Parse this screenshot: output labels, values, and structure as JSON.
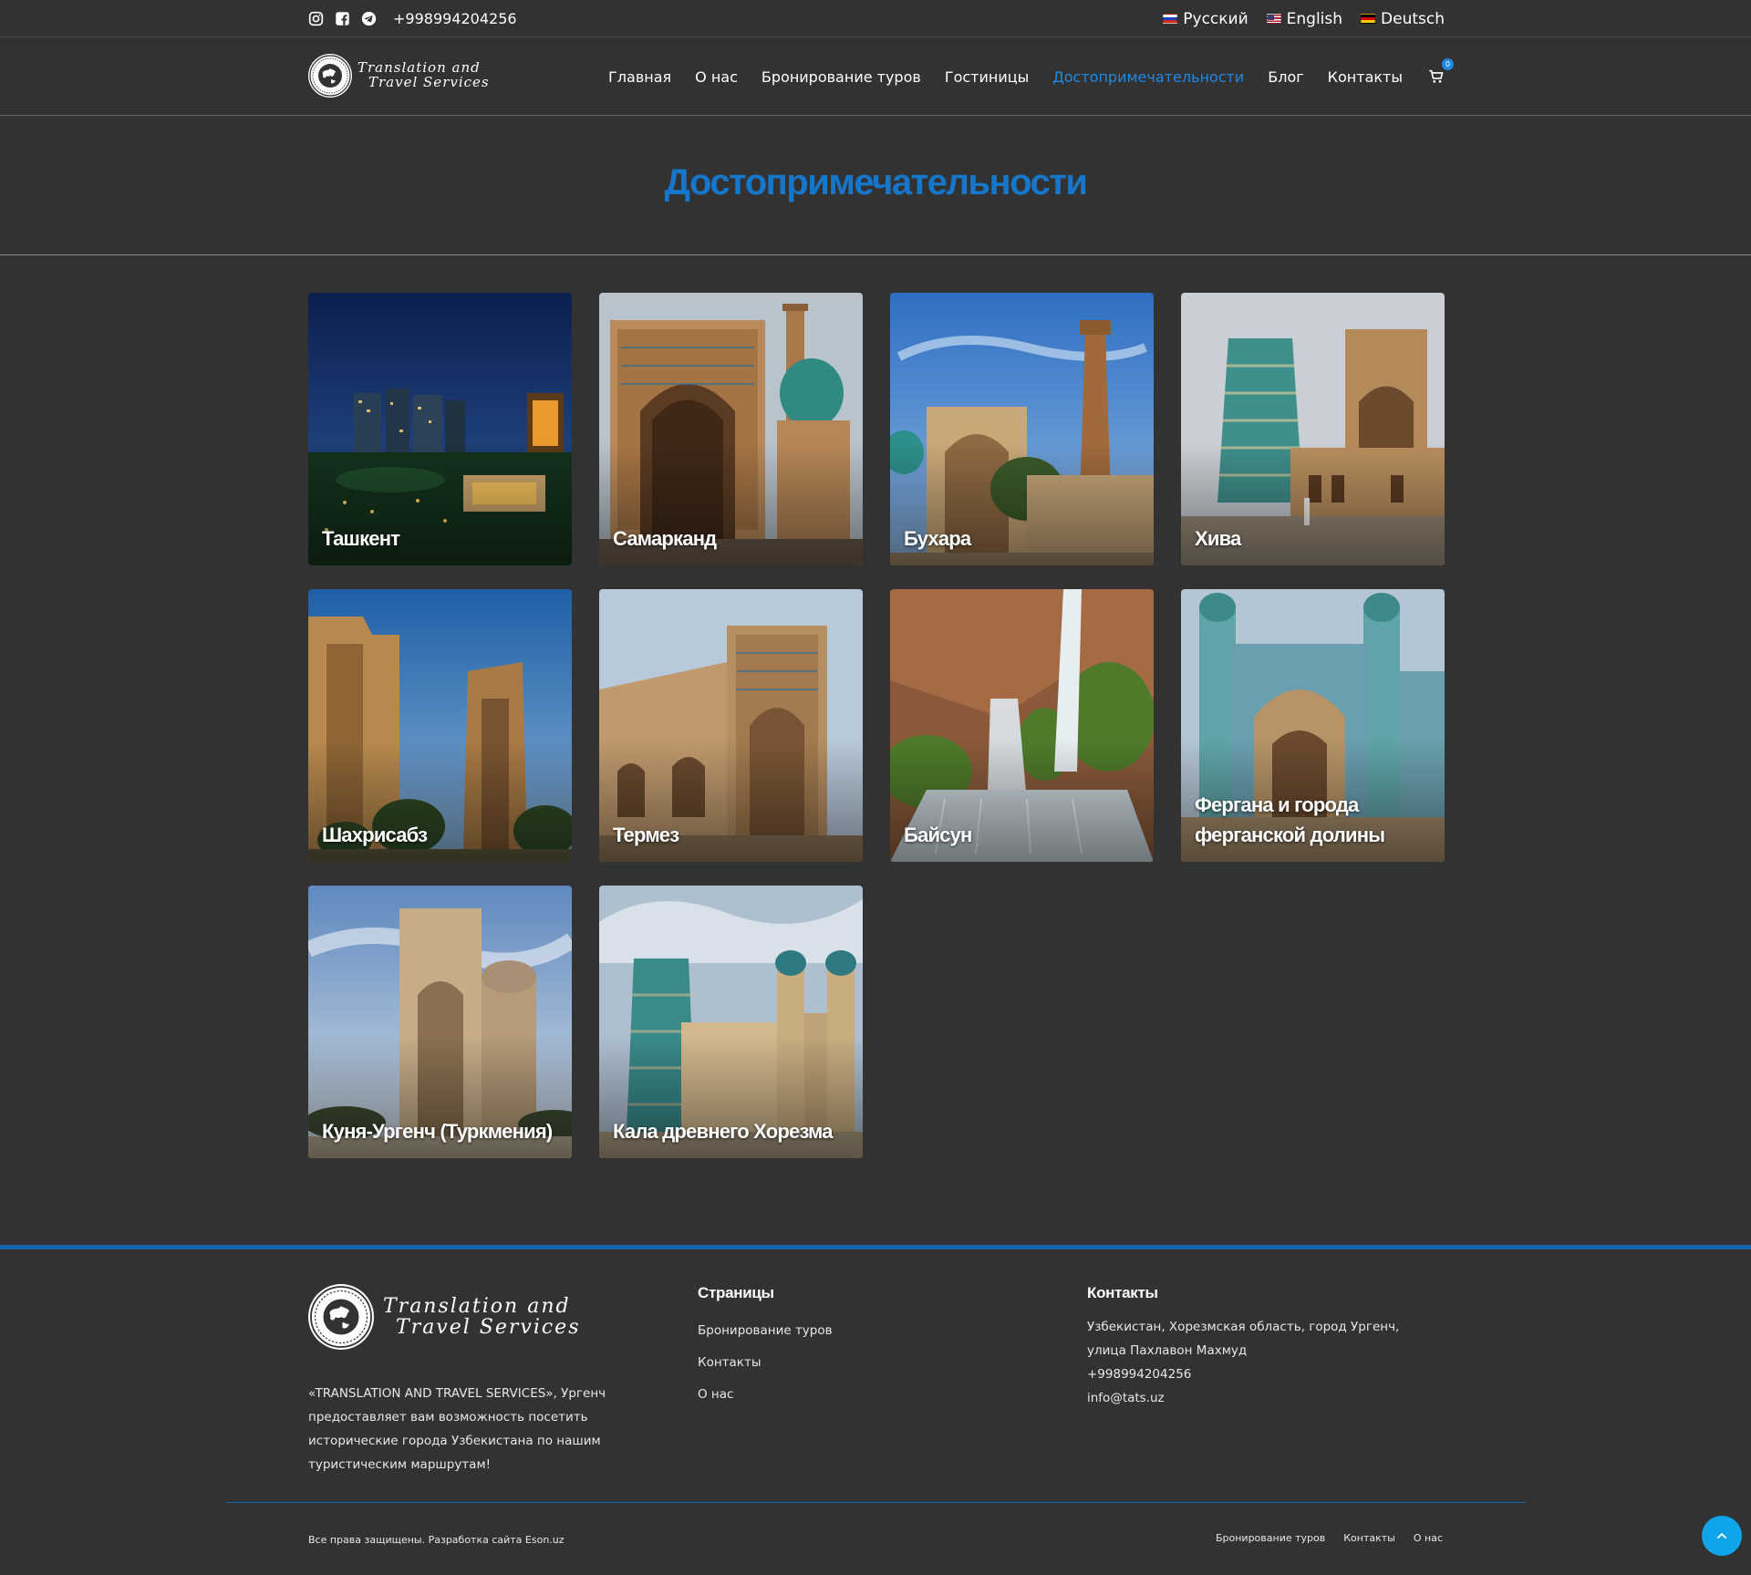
{
  "topbar": {
    "icons": [
      "instagram-icon",
      "facebook-icon",
      "telegram-icon"
    ],
    "phone": "+998994204256",
    "languages": [
      {
        "label": "Русский",
        "flag": "ru-flag-icon"
      },
      {
        "label": "English",
        "flag": "us-flag-icon"
      },
      {
        "label": "Deutsch",
        "flag": "de-flag-icon"
      }
    ]
  },
  "logo": {
    "line1": "Translation and",
    "line2": "Travel Services"
  },
  "nav": {
    "items": [
      {
        "label": "Главная",
        "active": false
      },
      {
        "label": "О нас",
        "active": false
      },
      {
        "label": "Бронирование туров",
        "active": false
      },
      {
        "label": "Гостиницы",
        "active": false
      },
      {
        "label": "Достопримечательности",
        "active": true
      },
      {
        "label": "Блог",
        "active": false
      },
      {
        "label": "Контакты",
        "active": false
      }
    ],
    "cart_count": "0",
    "active_color": "#1e88e5"
  },
  "page": {
    "title": "Достопримечательности"
  },
  "cards": [
    {
      "label": "Ташкент",
      "scene": "night city skyline"
    },
    {
      "label": "Самарканд",
      "scene": "madrasah portal with turquoise dome"
    },
    {
      "label": "Бухара",
      "scene": "minaret and portal under blue sky"
    },
    {
      "label": "Хива",
      "scene": "tiled minaret and old street"
    },
    {
      "label": "Шахрисабз",
      "scene": "ruined palace towers"
    },
    {
      "label": "Термез",
      "scene": "brick madrasah portal"
    },
    {
      "label": "Байсун",
      "scene": "mountain waterfall"
    },
    {
      "label": "Фергана и города ферганской долины",
      "scene": "tiled palace gate"
    },
    {
      "label": "Куня-Ургенч (Туркмения)",
      "scene": "mausoleum portal"
    },
    {
      "label": "Кала древнего Хорезма",
      "scene": "tiled minaret and fortress walls"
    }
  ],
  "footer": {
    "about": "«TRANSLATION AND TRAVEL SERVICES», Ургенч предоставляет вам возможность посетить исторические города Узбекистана по нашим туристическим маршрутам!",
    "pages_title": "Страницы",
    "pages": [
      "Бронирование туров",
      "Контакты",
      "О нас"
    ],
    "contacts_title": "Контакты",
    "address": "Узбекистан, Хорезмская область, город Ургенч, улица Пахлавон Махмуд",
    "phone": "+998994204256",
    "email": "info@tats.uz",
    "copyright": "Все права защищены. Разработка сайта Eson.uz",
    "bottom_links": [
      "Бронирование туров",
      "Контакты",
      "О нас"
    ],
    "accent": "#1666ad"
  },
  "scroll_top": {
    "icon": "chevron-up-icon",
    "color": "#0ea5e9"
  }
}
